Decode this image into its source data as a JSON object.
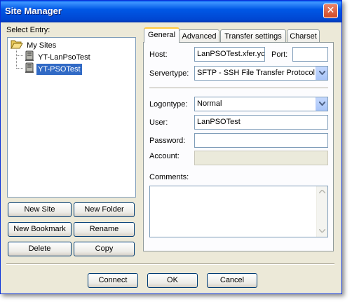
{
  "window": {
    "title": "Site Manager",
    "close_glyph": "✕"
  },
  "left": {
    "select_entry_label": "Select Entry:",
    "tree": {
      "root": {
        "label": "My Sites",
        "icon": "folder-open-icon"
      },
      "children": [
        {
          "label": "YT-LanPsoTest",
          "icon": "server-icon",
          "selected": false
        },
        {
          "label": "YT-PSOTest",
          "icon": "server-icon",
          "selected": true
        }
      ]
    },
    "buttons": {
      "new_site": "New Site",
      "new_folder": "New Folder",
      "new_bookmark": "New Bookmark",
      "rename": "Rename",
      "delete": "Delete",
      "copy": "Copy"
    }
  },
  "tabs": [
    "General",
    "Advanced",
    "Transfer settings",
    "Charset"
  ],
  "active_tab": "General",
  "general": {
    "host_label": "Host:",
    "host_value": "LanPSOTest.xfer.yc",
    "port_label": "Port:",
    "port_value": "",
    "servertype_label": "Servertype:",
    "servertype_value": "SFTP - SSH File Transfer Protocol",
    "logontype_label": "Logontype:",
    "logontype_value": "Normal",
    "user_label": "User:",
    "user_value": "LanPSOTest",
    "password_label": "Password:",
    "password_value": "",
    "account_label": "Account:",
    "account_value": "",
    "comments_label": "Comments:",
    "comments_value": ""
  },
  "footer": {
    "connect": "Connect",
    "ok": "OK",
    "cancel": "Cancel"
  },
  "colors": {
    "titlebar": "#0054e3",
    "selection": "#316ac5",
    "dialog_bg": "#ece9d8"
  }
}
